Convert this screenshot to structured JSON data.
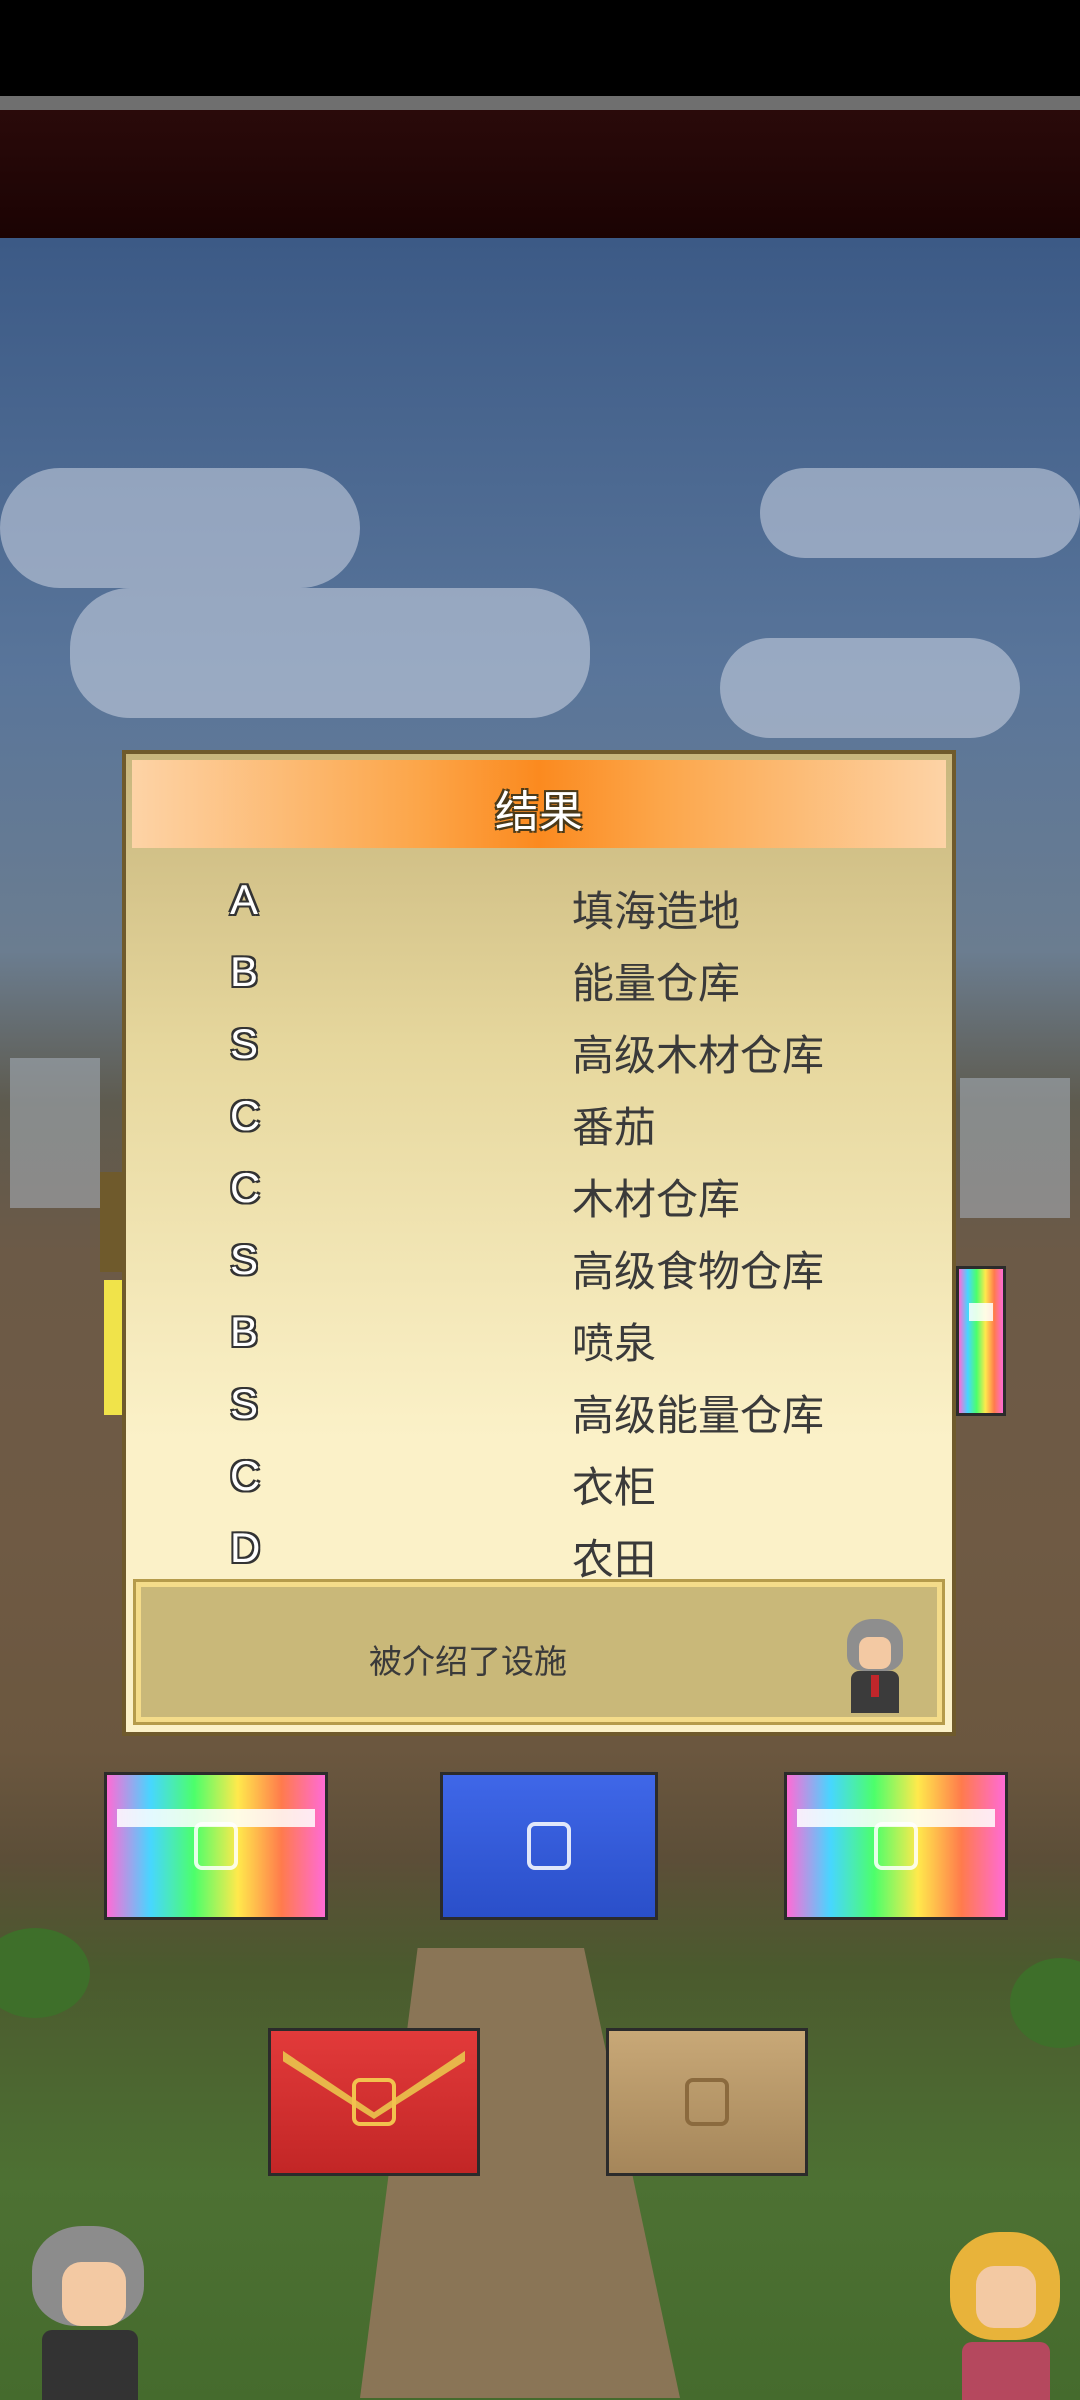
{
  "dialog": {
    "title": "结果",
    "results": [
      {
        "grade": "A",
        "facility": "填海造地"
      },
      {
        "grade": "B",
        "facility": "能量仓库"
      },
      {
        "grade": "S",
        "facility": "高级木材仓库"
      },
      {
        "grade": "C",
        "facility": "番茄"
      },
      {
        "grade": "C",
        "facility": "木材仓库"
      },
      {
        "grade": "S",
        "facility": "高级食物仓库"
      },
      {
        "grade": "B",
        "facility": "喷泉"
      },
      {
        "grade": "S",
        "facility": "高级能量仓库"
      },
      {
        "grade": "C",
        "facility": "衣柜"
      },
      {
        "grade": "D",
        "facility": "农田"
      }
    ],
    "message": "被介绍了设施"
  },
  "icons": {
    "npc": "advisor-portrait-icon",
    "chests": [
      "rainbow-chest-icon",
      "blue-chest-icon",
      "rainbow-chest-icon",
      "red-chest-icon",
      "wooden-chest-icon"
    ]
  },
  "colors": {
    "title_bar": "#fb8a1f",
    "dialog_bg": "#fbf1c8",
    "message_bg": "#c9b879"
  }
}
